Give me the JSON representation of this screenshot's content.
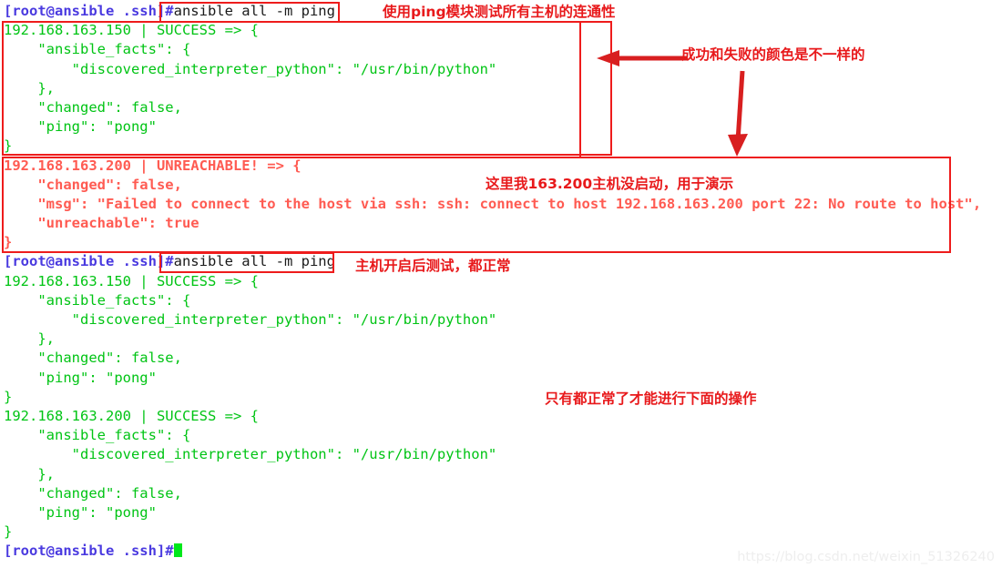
{
  "terminal": {
    "prompt": "[root@ansible .ssh]",
    "hash": "#",
    "lines": [
      {
        "id": "l01",
        "type": "prompt_cmd",
        "prompt": "[root@ansible .ssh]",
        "hash": "#",
        "command": "ansible all -m ping"
      },
      {
        "id": "l02",
        "type": "ok",
        "text": "192.168.163.150 | SUCCESS => {"
      },
      {
        "id": "l03",
        "type": "ok",
        "text": "    \"ansible_facts\": {"
      },
      {
        "id": "l04",
        "type": "ok",
        "text": "        \"discovered_interpreter_python\": \"/usr/bin/python\""
      },
      {
        "id": "l05",
        "type": "ok",
        "text": "    },"
      },
      {
        "id": "l06",
        "type": "ok",
        "text": "    \"changed\": false,"
      },
      {
        "id": "l07",
        "type": "ok",
        "text": "    \"ping\": \"pong\""
      },
      {
        "id": "l08",
        "type": "ok",
        "text": "}"
      },
      {
        "id": "l09",
        "type": "fail",
        "text": "192.168.163.200 | UNREACHABLE! => {"
      },
      {
        "id": "l10",
        "type": "fail",
        "text": "    \"changed\": false,"
      },
      {
        "id": "l11",
        "type": "fail",
        "text": "    \"msg\": \"Failed to connect to the host via ssh: ssh: connect to host 192.168.163.200 port 22: No route to host\","
      },
      {
        "id": "l12",
        "type": "fail",
        "text": "    \"unreachable\": true"
      },
      {
        "id": "l13",
        "type": "fail",
        "text": "}"
      },
      {
        "id": "l14",
        "type": "prompt_cmd",
        "prompt": "[root@ansible .ssh]",
        "hash": "#",
        "command": "ansible all -m ping"
      },
      {
        "id": "l15",
        "type": "ok",
        "text": "192.168.163.150 | SUCCESS => {"
      },
      {
        "id": "l16",
        "type": "ok",
        "text": "    \"ansible_facts\": {"
      },
      {
        "id": "l17",
        "type": "ok",
        "text": "        \"discovered_interpreter_python\": \"/usr/bin/python\""
      },
      {
        "id": "l18",
        "type": "ok",
        "text": "    },"
      },
      {
        "id": "l19",
        "type": "ok",
        "text": "    \"changed\": false,"
      },
      {
        "id": "l20",
        "type": "ok",
        "text": "    \"ping\": \"pong\""
      },
      {
        "id": "l21",
        "type": "ok",
        "text": "}"
      },
      {
        "id": "l22",
        "type": "ok",
        "text": "192.168.163.200 | SUCCESS => {"
      },
      {
        "id": "l23",
        "type": "ok",
        "text": "    \"ansible_facts\": {"
      },
      {
        "id": "l24",
        "type": "ok",
        "text": "        \"discovered_interpreter_python\": \"/usr/bin/python\""
      },
      {
        "id": "l25",
        "type": "ok",
        "text": "    },"
      },
      {
        "id": "l26",
        "type": "ok",
        "text": "    \"changed\": false,"
      },
      {
        "id": "l27",
        "type": "ok",
        "text": "    \"ping\": \"pong\""
      },
      {
        "id": "l28",
        "type": "ok",
        "text": "}"
      },
      {
        "id": "l29",
        "type": "prompt_cursor",
        "prompt": "[root@ansible .ssh]",
        "hash": "#"
      }
    ]
  },
  "annotations": {
    "note_ping_module": "使用ping模块测试所有主机的连通性",
    "note_color_differs": "成功和失败的颜色是不一样的",
    "note_host_down": "这里我163.200主机没启动，用于演示",
    "note_after_boot": "主机开启后测试，都正常",
    "note_all_normal": "只有都正常了才能进行下面的操作"
  },
  "watermark": "https://blog.csdn.net/weixin_51326240",
  "colors": {
    "success_green": "#00c414",
    "fail_red": "#ff5b52",
    "prompt_blue": "#4a3ae0",
    "annotation_red": "#e8191b",
    "cursor_green": "#00e81b"
  }
}
